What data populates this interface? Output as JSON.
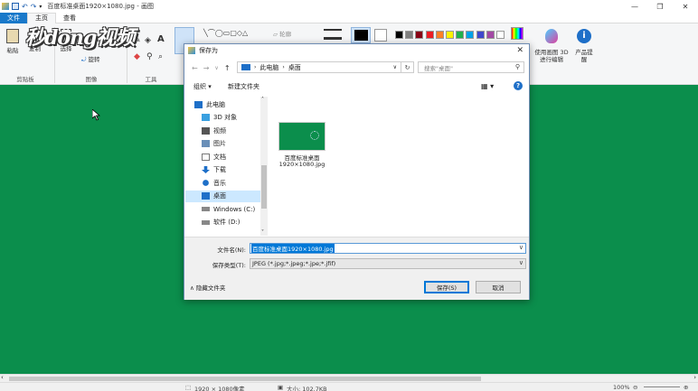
{
  "window": {
    "title": "百度标准桌面1920×1080.jpg - 画图",
    "minimize": "—",
    "maximize": "❐",
    "close": "✕"
  },
  "ribbon_tabs": [
    "文件",
    "主页",
    "查看"
  ],
  "ribbon": {
    "paste": "粘贴",
    "copy": "复制",
    "select": "选择",
    "rotate": "旋转",
    "group_clipboard": "剪贴板",
    "group_image": "图像",
    "group_tools": "工具",
    "outline": "轮廓",
    "paint3d": "使用画图 3D 进行编辑",
    "product_alert": "产品提醒",
    "palette": [
      "#000000",
      "#7f7f7f",
      "#880015",
      "#ed1c24",
      "#ff7f27",
      "#fff200",
      "#22b14c",
      "#00a2e8",
      "#3f48cc",
      "#a349a4",
      "#ffffff"
    ]
  },
  "watermark": "秒dong视频",
  "dialog": {
    "title": "保存为",
    "close": "✕",
    "address": [
      "此电脑",
      "桌面"
    ],
    "search_placeholder": "搜索\"桌面\"",
    "organize": "组织 ▾",
    "new_folder": "新建文件夹",
    "help": "?",
    "nav_items": [
      {
        "label": "此电脑",
        "icon": "computer-icon"
      },
      {
        "label": "3D 对象",
        "icon": "3d-objects-icon"
      },
      {
        "label": "视频",
        "icon": "video-icon"
      },
      {
        "label": "图片",
        "icon": "pictures-icon"
      },
      {
        "label": "文档",
        "icon": "documents-icon"
      },
      {
        "label": "下载",
        "icon": "download-icon"
      },
      {
        "label": "音乐",
        "icon": "music-icon"
      },
      {
        "label": "桌面",
        "icon": "desktop-icon"
      },
      {
        "label": "Windows (C:)",
        "icon": "drive-c-icon"
      },
      {
        "label": "软件 (D:)",
        "icon": "drive-d-icon"
      }
    ],
    "file": {
      "name_line1": "百度标准桌面",
      "name_line2": "1920×1080.jpg"
    },
    "filename_label": "文件名(N):",
    "filename_value": "百度标准桌面1920×1080.jpg",
    "filetype_label": "保存类型(T):",
    "filetype_value": "JPEG (*.jpg;*.jpeg;*.jpe;*.jfif)",
    "hide_folders": "∧ 隐藏文件夹",
    "save": "保存(S)",
    "cancel": "取消"
  },
  "status": {
    "dimensions": "1920 × 1080像素",
    "size": "大小: 102.7KB",
    "zoom": "100%"
  }
}
